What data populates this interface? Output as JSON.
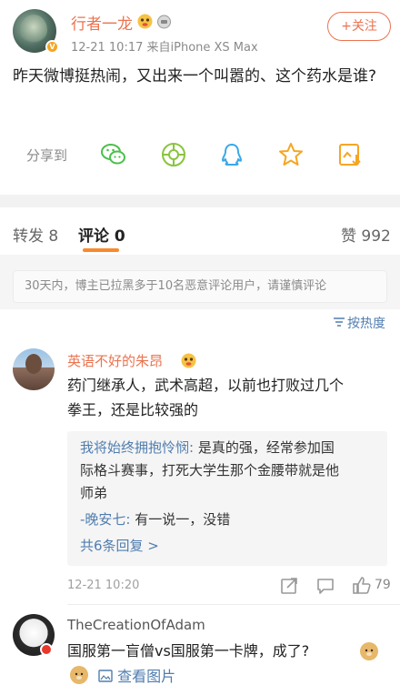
{
  "post": {
    "username": "行者一龙",
    "meta": "12-21 10:17  来自iPhone XS Max",
    "follow_label": "+关注",
    "text": "昨天微博挺热闹，又出来一个叫嚣的、这个药水是谁?",
    "share_label": "分享到"
  },
  "tabs": {
    "repost": "转发 8",
    "comment": "评论 0",
    "likes": "赞 992"
  },
  "notice": "30天内，博主已拉黑多于10名恶意评论用户，请谨慎评论",
  "sort_label": "按热度",
  "comments": [
    {
      "username": "英语不好的朱昂",
      "text_line1": "药门继承人，武术高超，以前也打败过几个",
      "text_line2": "拳王，还是比较强的",
      "replies": {
        "r1_name": "我将始终拥抱怜悯:",
        "r1_text1": " 是真的强，经常参加国",
        "r1_text2": "际格斗赛事，打死大学生那个金腰带就是他",
        "r1_text3": "师弟",
        "r2_name": "-晚安七:",
        "r2_text": " 有一说一，没错",
        "more": "共6条回复 >"
      },
      "time": "12-21 10:20",
      "likes": "79"
    },
    {
      "username": "TheCreationOfAdam",
      "text": "国服第一盲僧vs国服第一卡牌，成了?",
      "view_pic": "查看图片"
    }
  ],
  "colors": {
    "accent_orange": "#eb7350",
    "link_blue": "#507daf",
    "tab_underline": "#f78a2d"
  }
}
